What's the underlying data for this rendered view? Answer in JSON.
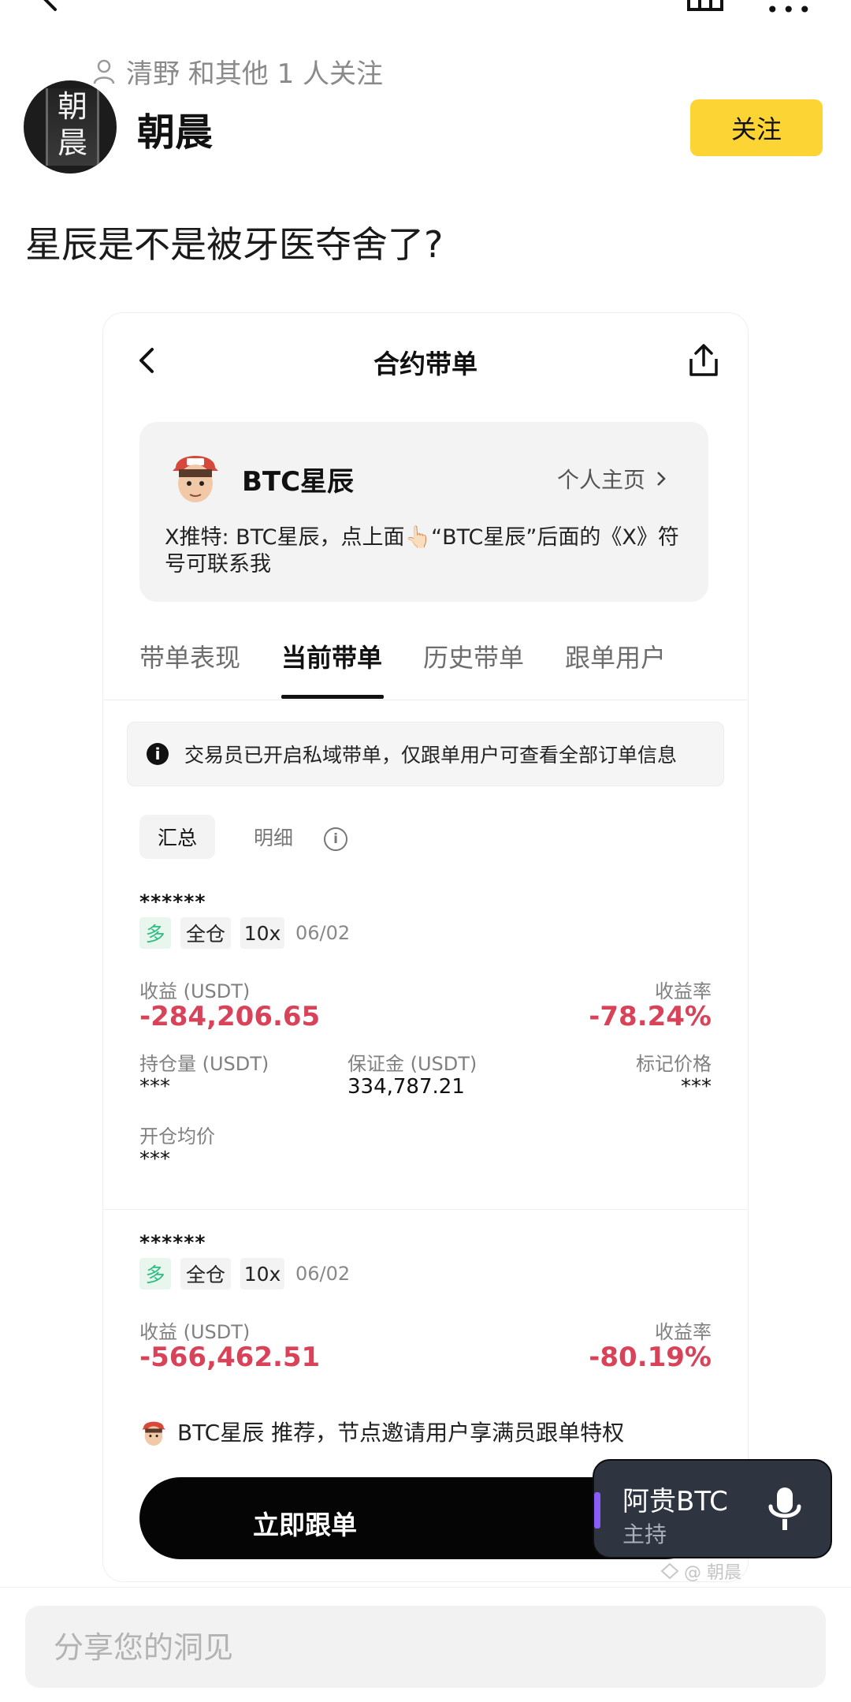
{
  "post": {
    "follower_line": "清野 和其他 1 人关注",
    "author": "朝晨",
    "avatar_text": "朝晨",
    "follow_label": "关注",
    "text": "星辰是不是被牙医夺舍了?"
  },
  "screenshot": {
    "title": "合约带单",
    "trader": {
      "name": "BTC星辰",
      "profile_link": "个人主页",
      "bio": "X推特: BTC星辰，点上面👆🏻“BTC星辰”后面的《X》符号可联系我"
    },
    "tabs": [
      "带单表现",
      "当前带单",
      "历史带单",
      "跟单用户"
    ],
    "active_tab": "当前带单",
    "notice": "交易员已开启私域带单，仅跟单用户可查看全部订单信息",
    "segments": [
      "汇总",
      "明细"
    ],
    "positions": [
      {
        "symbol": "******",
        "side": "多",
        "margin_mode": "全仓",
        "leverage": "10x",
        "date": "06/02",
        "pnl_label": "收益 (USDT)",
        "pnl": "-284,206.65",
        "roi_label": "收益率",
        "roi": "-78.24%",
        "size_label": "持仓量 (USDT)",
        "size": "***",
        "margin_label": "保证金 (USDT)",
        "margin": "334,787.21",
        "mark_label": "标记价格",
        "mark": "***",
        "entry_label": "开仓均价",
        "entry": "***"
      },
      {
        "symbol": "******",
        "side": "多",
        "margin_mode": "全仓",
        "leverage": "10x",
        "date": "06/02",
        "pnl_label": "收益 (USDT)",
        "pnl": "-566,462.51",
        "roi_label": "收益率",
        "roi": "-80.19%"
      }
    ],
    "recommend": "BTC星辰 推荐，节点邀请用户享满员跟单特权",
    "copy_button": "立即跟单"
  },
  "live": {
    "name": "阿贵BTC",
    "role": "主持"
  },
  "watermark": "@ 朝晨",
  "comment": {
    "placeholder": "分享您的洞见"
  },
  "colors": {
    "accent_yellow": "#fcd535",
    "loss_red": "#d9435a",
    "long_green": "#2ebd85",
    "live_bar": "#8a5cf6"
  },
  "icons": {
    "top": [
      "back-arrow-icon",
      "home-icon",
      "more-icon"
    ],
    "trader_avatar": "cartoon-avatar-icon"
  }
}
